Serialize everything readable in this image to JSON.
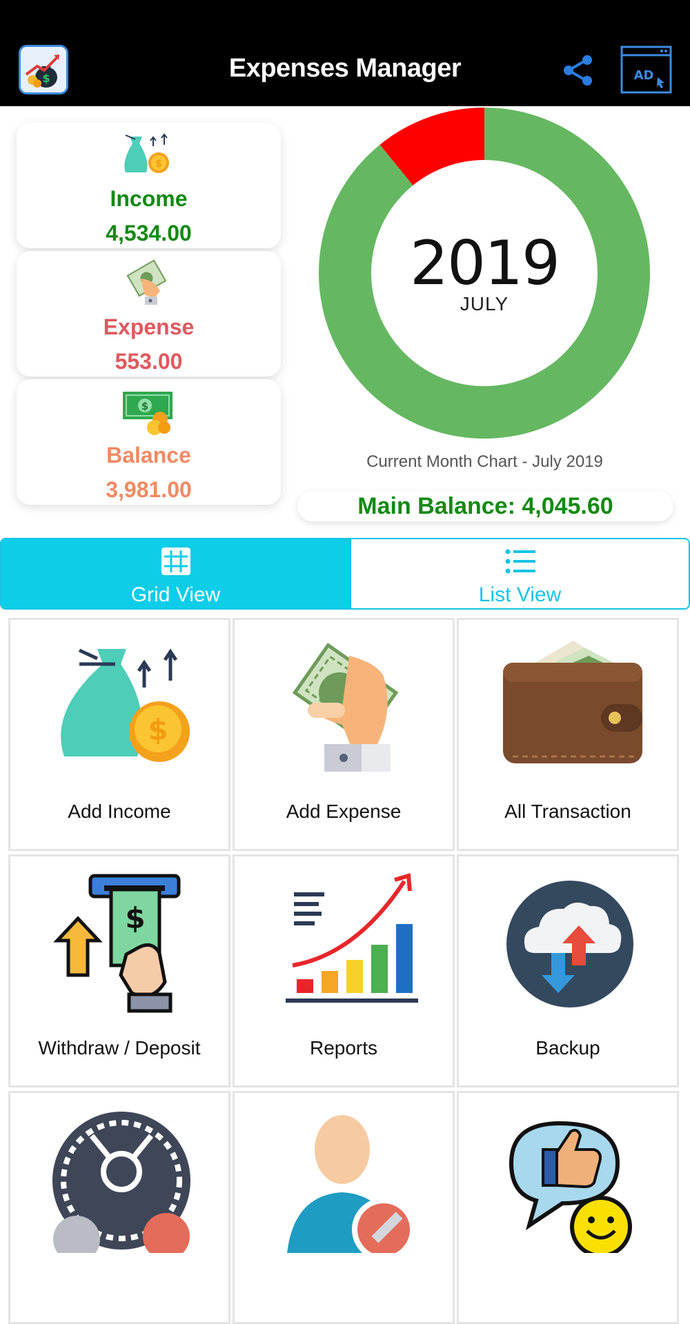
{
  "header": {
    "title": "Expenses Manager",
    "logo_icon": "money-bag-growth-icon",
    "share_icon": "share-icon",
    "ad_icon": "ad-browser-icon",
    "ad_text": "AD"
  },
  "summary": {
    "income": {
      "label": "Income",
      "value": "4,534.00",
      "color": "#138a13"
    },
    "expense": {
      "label": "Expense",
      "value": "553.00",
      "color": "#e0585e"
    },
    "balance": {
      "label": "Balance",
      "value": "3,981.00",
      "color": "#f08a63"
    }
  },
  "chart_data": {
    "type": "pie",
    "variant": "donut",
    "center_year": "2019",
    "center_month": "JULY",
    "caption": "Current Month Chart - July 2019",
    "slices": [
      {
        "name": "Income",
        "value": 4534,
        "color": "#65b861"
      },
      {
        "name": "Expense",
        "value": 553,
        "color": "#ff0000"
      }
    ]
  },
  "main_balance": {
    "text": "Main Balance: 4,045.60"
  },
  "tabs": [
    {
      "label": "Grid View",
      "icon": "grid-icon",
      "active": true
    },
    {
      "label": "List View",
      "icon": "list-icon",
      "active": false
    }
  ],
  "tiles": [
    {
      "label": "Add Income",
      "icon": "income-bag-icon"
    },
    {
      "label": "Add Expense",
      "icon": "hand-cash-icon"
    },
    {
      "label": "All Transaction",
      "icon": "wallet-icon"
    },
    {
      "label": "Withdraw / Deposit",
      "icon": "atm-withdraw-icon"
    },
    {
      "label": "Reports",
      "icon": "bar-chart-growth-icon"
    },
    {
      "label": "Backup",
      "icon": "cloud-sync-icon"
    },
    {
      "label": "",
      "icon": "settings-gear-icon"
    },
    {
      "label": "",
      "icon": "user-edit-icon"
    },
    {
      "label": "",
      "icon": "rate-thumbs-up-icon"
    }
  ],
  "colors": {
    "accent": "#0dcde8",
    "donut_green": "#65b861",
    "donut_red": "#ff0000",
    "main_balance": "#138a13"
  }
}
